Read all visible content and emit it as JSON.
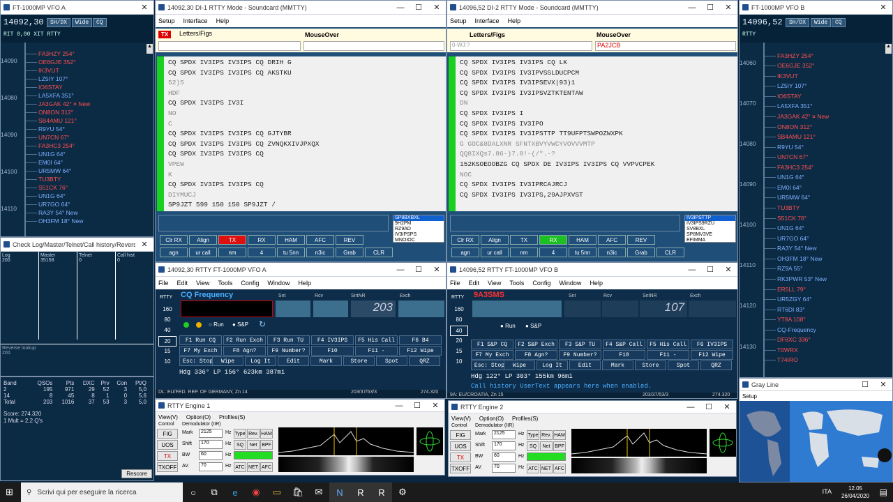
{
  "vfoA_panel": {
    "title": "FT-1000MP VFO A",
    "freq": "14092,30",
    "buttons": [
      "SH/DX",
      "Wide",
      "CQ"
    ],
    "rit": "RIT  0,00  XIT  RTTY",
    "freqs": [
      "14090",
      "14080",
      "14090",
      "14100",
      "14110"
    ],
    "calls": [
      {
        "t": "FA3HZY 254°",
        "c": "#ff5050"
      },
      {
        "t": "OE6GJE 352°",
        "c": "#ff5050"
      },
      {
        "t": "IK3VUT",
        "c": "#ff5050"
      },
      {
        "t": "LZ5IY 107°",
        "c": "#7fb0ff"
      },
      {
        "t": "IO6STAY",
        "c": "#ff5050"
      },
      {
        "t": "LA5XFA 351°",
        "c": "#7fb0ff"
      },
      {
        "t": "JA3GAK 42° ¤ New",
        "c": "#ff5050"
      },
      {
        "t": "ON8ON 312°",
        "c": "#ff5050"
      },
      {
        "t": "SB4AMU 121°",
        "c": "#ff5050"
      },
      {
        "t": "R9YU 54°",
        "c": "#7fb0ff"
      },
      {
        "t": "UN7CN 67°",
        "c": "#ff5050"
      },
      {
        "t": "FA3HC3 254°",
        "c": "#ff5050"
      },
      {
        "t": "UN1G 64°",
        "c": "#7fb0ff"
      },
      {
        "t": "EM0I 64°",
        "c": "#7fb0ff"
      },
      {
        "t": "UR5MW 64°",
        "c": "#7fb0ff"
      },
      {
        "t": "TU3BTY",
        "c": "#ff5050"
      },
      {
        "t": "S51CK 76°",
        "c": "#ff5050"
      },
      {
        "t": "UN1G 64°",
        "c": "#7fb0ff"
      },
      {
        "t": "UR7GO 64°",
        "c": "#7fb0ff"
      },
      {
        "t": "RA3Y 54° New",
        "c": "#7fb0ff"
      },
      {
        "t": "OH3FM 18° New",
        "c": "#7fb0ff"
      }
    ]
  },
  "check_log": {
    "title": "Check Log/Master/Telnet/Call history/Reverse lo...",
    "cols": [
      {
        "h": "Log",
        "v": "200"
      },
      {
        "h": "Master",
        "v": "35158"
      },
      {
        "h": "Telnet",
        "v": "0"
      },
      {
        "h": "Call hist",
        "v": "0"
      }
    ],
    "reverse": "Reverse lookup",
    "reverse_val": "200"
  },
  "score": {
    "headers": [
      "Band",
      "QSOs",
      "Pts",
      "DXC",
      "Prv",
      "Con",
      "Pt/Q"
    ],
    "rows": [
      [
        "2",
        "195",
        "971",
        "29",
        "52",
        "3",
        "5,0"
      ],
      [
        "14",
        "8",
        "45",
        "8",
        "1",
        "0",
        "5,6"
      ],
      [
        "Total",
        "203",
        "1016",
        "37",
        "53",
        "3",
        "5,0"
      ]
    ],
    "score": "Score: 274.320",
    "mult": "1 Mult = 2,2 Q's",
    "rescore": "Rescore"
  },
  "mmtty1": {
    "title": "14092,30  DI-1 RTTY Mode - Soundcard (MMTTY)",
    "menu": [
      "Setup",
      "Interface",
      "Help"
    ],
    "tx": "TX",
    "letters": "Letters/Figs",
    "mouseover": "MouseOver",
    "lines": [
      "CQ SPDX IV3IPS IV3IPS CQ DRIH G",
      "CQ SPDX IV3IPS IV3IPS CQ AKSTKU",
      "52)5",
      "HDF",
      "CQ SPDX IV3IPS IV3I",
      "NO",
      "C",
      "CQ SPDX IV3IPS IV3IPS CQ GJTYBR",
      "CQ SPDX IV3IPS IV3IPS CQ ZVNQKXIVJPXQX",
      "CQ SPDX IV3IPS IV3IPS CQ",
      "VPEW",
      "K",
      "CQ SPDX IV3IPS IV3IPS CQ",
      "DIYMUCJ",
      "SP9JZT 599 150 150 SP9JZT /"
    ],
    "list": [
      "SP8BXBXL",
      "9H2PM",
      "RZ9AD",
      "IV3IPSPS",
      "MNOIOC"
    ],
    "btns": [
      "Clr RX",
      "Align",
      "TX",
      "RX",
      "HAM",
      "AFC",
      "REV"
    ],
    "btns2": [
      "agn",
      "ur call",
      "nm",
      "4",
      "tu 5nn",
      "n3ic",
      "Grab",
      "CLR"
    ]
  },
  "mmtty2": {
    "title": "14096,52  DI-2 RTTY Mode - Soundcard (MMTTY)",
    "menu": [
      "Setup",
      "Interface",
      "Help"
    ],
    "letters": "Letters/Figs",
    "mouseover": "MouseOver",
    "left_field": "0-WJ:?",
    "right_field": "PA2JCB",
    "lines": [
      "CQ SPDX IV3IPS IV3IPS CQ LK",
      "CQ SPDX IV3IPS IV3IPVSSLDUCPCM",
      "CQ SPDX IV3IPS IV3IPSEVX|93)1",
      "CQ SPDX IV3IPS IV3IPSVZTKTENTAW",
      "DN",
      "CQ SPDX IV3IPS I",
      "CQ SPDX IV3IPS IV3IPO",
      "CQ SPDX IV3IPS IV3IPSTTP TT9UFPTSWPOZWXPK",
      "G GOC&8DALXNR SFNTXBVYVWCYVOVVVMTP",
      "QQ8IXQs7.86-)7.8!-(/\".-?",
      "152KSOEOOBZG CQ SPDX DE IV3IPS IV3IPS CQ VVPVCPEK",
      "NOC",
      "CQ SPDX IV3IPS IV3IPRCAJRCJ",
      "CQ SPDX IV3IPS IV3IPS,29AJPXVST"
    ],
    "list": [
      "IV3IPSTTP",
      "IV3IPS9RZU",
      "SV8BXL",
      "SP8MV3VE",
      "EFIMMA"
    ],
    "btns": [
      "Clr RX",
      "Align",
      "TX",
      "RX",
      "HAM",
      "AFC",
      "REV"
    ],
    "btns2": [
      "agn",
      "ur call",
      "nm",
      "4",
      "tu 5nn",
      "n3ic",
      "Grab",
      "CLR"
    ]
  },
  "rttyA": {
    "title": "14092,30  RTTY  FT-1000MP VFO A",
    "menu": [
      "File",
      "Edit",
      "View",
      "Tools",
      "Config",
      "Window",
      "Help"
    ],
    "cq": "CQ Frequency",
    "labels": [
      "Snt",
      "Rcv",
      "SntNR",
      "Exch"
    ],
    "sntnr": "203",
    "mode": "RTTY",
    "bands": [
      "160",
      "80",
      "40",
      "20",
      "15",
      "10"
    ],
    "run": "Run",
    "sp": "S&P",
    "fkeys": [
      "F1 Run CQ",
      "F2 Run Exch",
      "F3 Run TU",
      "F4 IV3IPS",
      "F5 His Call",
      "F6 B4",
      "F7 My Exch",
      "F8 Agn?",
      "F9 Number?",
      "F10",
      "F11 -",
      "F12 Wipe"
    ],
    "actions": [
      "Esc: Stop",
      "Wipe",
      "Log It",
      "Edit",
      "Mark",
      "Store",
      "Spot",
      "QRZ"
    ],
    "heading": "Hdg 336°  LP 156°  623km  387mi",
    "status": "DL: EU/FED. REP. OF GERMANY, Zn 14",
    "status2": "203/37/53/3",
    "status3": "274.320"
  },
  "rttyB": {
    "title": "14096,52  RTTY  FT-1000MP VFO B",
    "menu": [
      "File",
      "Edit",
      "View",
      "Tools",
      "Config",
      "Window",
      "Help"
    ],
    "call": "9A3SMS",
    "labels": [
      "Snt",
      "Rcv",
      "SntNR",
      "Exch"
    ],
    "sntnr": "107",
    "mode": "RTTY",
    "bands": [
      "160",
      "80",
      "40",
      "20",
      "15",
      "10"
    ],
    "run": "Run",
    "sp": "S&P",
    "fkeys": [
      "F1 S&P CQ",
      "F2 S&P Exch",
      "F3 S&P TU",
      "F4 S&P Call",
      "F5 His Call",
      "F6 IV3IPS",
      "F7 My Exch",
      "F8 Agn?",
      "F9 Number?",
      "F10",
      "F11 -",
      "F12 Wipe"
    ],
    "actions": [
      "Esc: Stop",
      "Wipe",
      "Log It",
      "Edit",
      "Mark",
      "Store",
      "Spot",
      "QRZ"
    ],
    "heading": "Hdg 122°  LP 303°  155km  96mi",
    "note": "Call history UserText appears here when enabled.",
    "status": "9A: EU/CROATIA, Zn 15",
    "status2": "203/37/53/3",
    "status3": "274.320"
  },
  "engine1": {
    "title": "RTTY Engine 1",
    "menu": [
      "View(V)",
      "Option(O)",
      "Profiles(S)"
    ],
    "control": "Control",
    "demod": "Demodulator (IIR)",
    "side": [
      "FIG",
      "UOS",
      "TX",
      "TXOFF"
    ],
    "rows": [
      {
        "l": "Mark",
        "v": "2125",
        "u": "Hz"
      },
      {
        "l": "Shift",
        "v": "170",
        "u": "Hz"
      },
      {
        "l": "BW",
        "v": "60",
        "u": "Hz"
      },
      {
        "l": "AV.",
        "v": "70",
        "u": "Hz"
      }
    ],
    "grid": [
      "Type",
      "Rev.",
      "HAM",
      "SQ",
      "Net",
      "BPF",
      "ATC",
      "NET",
      "AFC"
    ]
  },
  "engine2": {
    "title": "RTTY Engine 2",
    "menu": [
      "View(V)",
      "Option(O)",
      "Profiles(S)"
    ],
    "control": "Control",
    "demod": "Demodulator (IIR)",
    "side": [
      "FIG",
      "UOS",
      "TX",
      "TXOFF"
    ],
    "rows": [
      {
        "l": "Mark",
        "v": "2125",
        "u": "Hz"
      },
      {
        "l": "Shift",
        "v": "170",
        "u": "Hz"
      },
      {
        "l": "BW",
        "v": "60",
        "u": "Hz"
      },
      {
        "l": "AV.",
        "v": "70",
        "u": "Hz"
      }
    ],
    "grid": [
      "Type",
      "Rev.",
      "HAM",
      "SQ",
      "Net",
      "BPF",
      "ATC",
      "NET",
      "AFC"
    ]
  },
  "vfoB_panel": {
    "title": "FT-1000MP VFO B",
    "freq": "14096,52",
    "buttons": [
      "SH/DX",
      "Wide",
      "CQ"
    ],
    "mode": "RTTY",
    "freqs": [
      "14060",
      "14070",
      "14080",
      "14090",
      "14100",
      "14110",
      "14120",
      "14130"
    ],
    "calls": [
      {
        "t": "FA3HZY 254°",
        "c": "#ff5050"
      },
      {
        "t": "OE6GJE 352°",
        "c": "#ff5050"
      },
      {
        "t": "IK3VUT",
        "c": "#ff5050"
      },
      {
        "t": "LZ5IY 107°",
        "c": "#7fb0ff"
      },
      {
        "t": "IO6STAY",
        "c": "#ff5050"
      },
      {
        "t": "LA5XFA 351°",
        "c": "#7fb0ff"
      },
      {
        "t": "JA3GAK 42° ¤ New",
        "c": "#ff5050"
      },
      {
        "t": "ON8ON 312°",
        "c": "#ff5050"
      },
      {
        "t": "SB4AMU 121°",
        "c": "#ff5050"
      },
      {
        "t": "R9YU 54°",
        "c": "#7fb0ff"
      },
      {
        "t": "UN7CN 67°",
        "c": "#ff5050"
      },
      {
        "t": "FA3HC3 254°",
        "c": "#ff5050"
      },
      {
        "t": "UN1G 64°",
        "c": "#7fb0ff"
      },
      {
        "t": "EM0I 64°",
        "c": "#7fb0ff"
      },
      {
        "t": "UR5MW 64°",
        "c": "#7fb0ff"
      },
      {
        "t": "TU3BTY",
        "c": "#ff5050"
      },
      {
        "t": "S51CK 76°",
        "c": "#ff5050"
      },
      {
        "t": "UN1G 64°",
        "c": "#7fb0ff"
      },
      {
        "t": "UR7GO 64°",
        "c": "#7fb0ff"
      },
      {
        "t": "RA3Y 54° New",
        "c": "#7fb0ff"
      },
      {
        "t": "OH3FM 18° New",
        "c": "#7fb0ff"
      },
      {
        "t": "RZ9A 55°",
        "c": "#7fb0ff"
      },
      {
        "t": "RK3PWR 53° New",
        "c": "#7fb0ff"
      },
      {
        "t": "ER5LL 79°",
        "c": "#ff5050"
      },
      {
        "t": "UR5ZGY 64°",
        "c": "#7fb0ff"
      },
      {
        "t": "RT6DI 83°",
        "c": "#7fb0ff"
      },
      {
        "t": "YT8A 108°",
        "c": "#ff5050"
      },
      {
        "t": "CQ-Frequency",
        "c": "#7fb0ff"
      },
      {
        "t": "DF8XC 336°",
        "c": "#ff5050"
      },
      {
        "t": "T0WRX",
        "c": "#ff5050"
      },
      {
        "t": "T74IRO",
        "c": "#ff5050"
      }
    ]
  },
  "grayline": {
    "title": "Gray Line",
    "menu": "Setup"
  },
  "taskbar": {
    "search": "Scrivi qui per eseguire la ricerca",
    "time": "12.05",
    "date": "26/04/2020",
    "lang": "ITA"
  }
}
